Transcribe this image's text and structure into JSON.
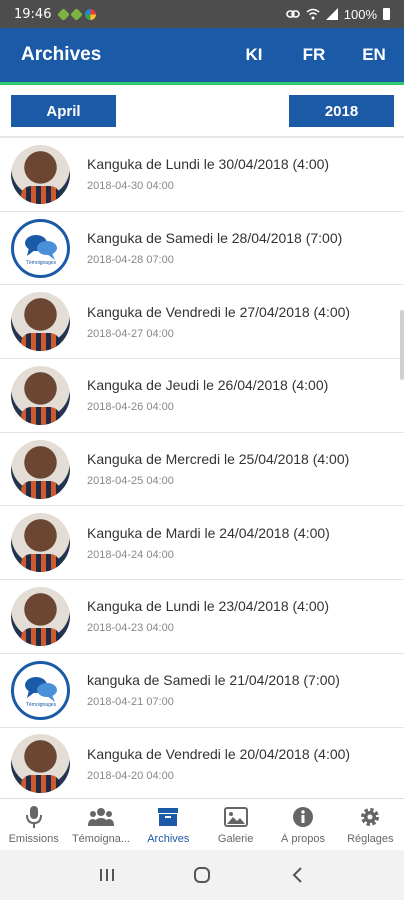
{
  "status_bar": {
    "time": "19:46",
    "battery": "100%"
  },
  "app_bar": {
    "title": "Archives",
    "languages": [
      "KI",
      "FR",
      "EN"
    ]
  },
  "filters": {
    "month": "April",
    "year": "2018"
  },
  "archives": [
    {
      "title": "Kanguka de Lundi le 30/04/2018 (4:00)",
      "date": "2018-04-30 04:00",
      "avatar": "person"
    },
    {
      "title": "Kanguka de Samedi le 28/04/2018 (7:00)",
      "date": "2018-04-28 07:00",
      "avatar": "testimony"
    },
    {
      "title": "Kanguka de Vendredi le 27/04/2018 (4:00)",
      "date": "2018-04-27 04:00",
      "avatar": "person"
    },
    {
      "title": "Kanguka de Jeudi le 26/04/2018 (4:00)",
      "date": "2018-04-26 04:00",
      "avatar": "person"
    },
    {
      "title": "Kanguka de Mercredi le 25/04/2018 (4:00)",
      "date": "2018-04-25 04:00",
      "avatar": "person"
    },
    {
      "title": "Kanguka de Mardi le 24/04/2018 (4:00)",
      "date": "2018-04-24 04:00",
      "avatar": "person"
    },
    {
      "title": "Kanguka de Lundi le 23/04/2018 (4:00)",
      "date": "2018-04-23 04:00",
      "avatar": "person"
    },
    {
      "title": "kanguka de Samedi le 21/04/2018 (7:00)",
      "date": "2018-04-21 07:00",
      "avatar": "testimony"
    },
    {
      "title": "Kanguka de Vendredi le 20/04/2018 (4:00)",
      "date": "2018-04-20 04:00",
      "avatar": "person"
    }
  ],
  "bottom_nav": [
    {
      "label": "Emissions",
      "icon": "microphone-icon"
    },
    {
      "label": "Témoigna...",
      "icon": "people-icon"
    },
    {
      "label": "Archives",
      "icon": "archive-icon",
      "active": true
    },
    {
      "label": "Galerie",
      "icon": "image-icon"
    },
    {
      "label": "À propos",
      "icon": "info-icon"
    },
    {
      "label": "Réglages",
      "icon": "gear-icon"
    }
  ],
  "colors": {
    "primary": "#1b5aa6",
    "accent": "#2ecc71"
  }
}
